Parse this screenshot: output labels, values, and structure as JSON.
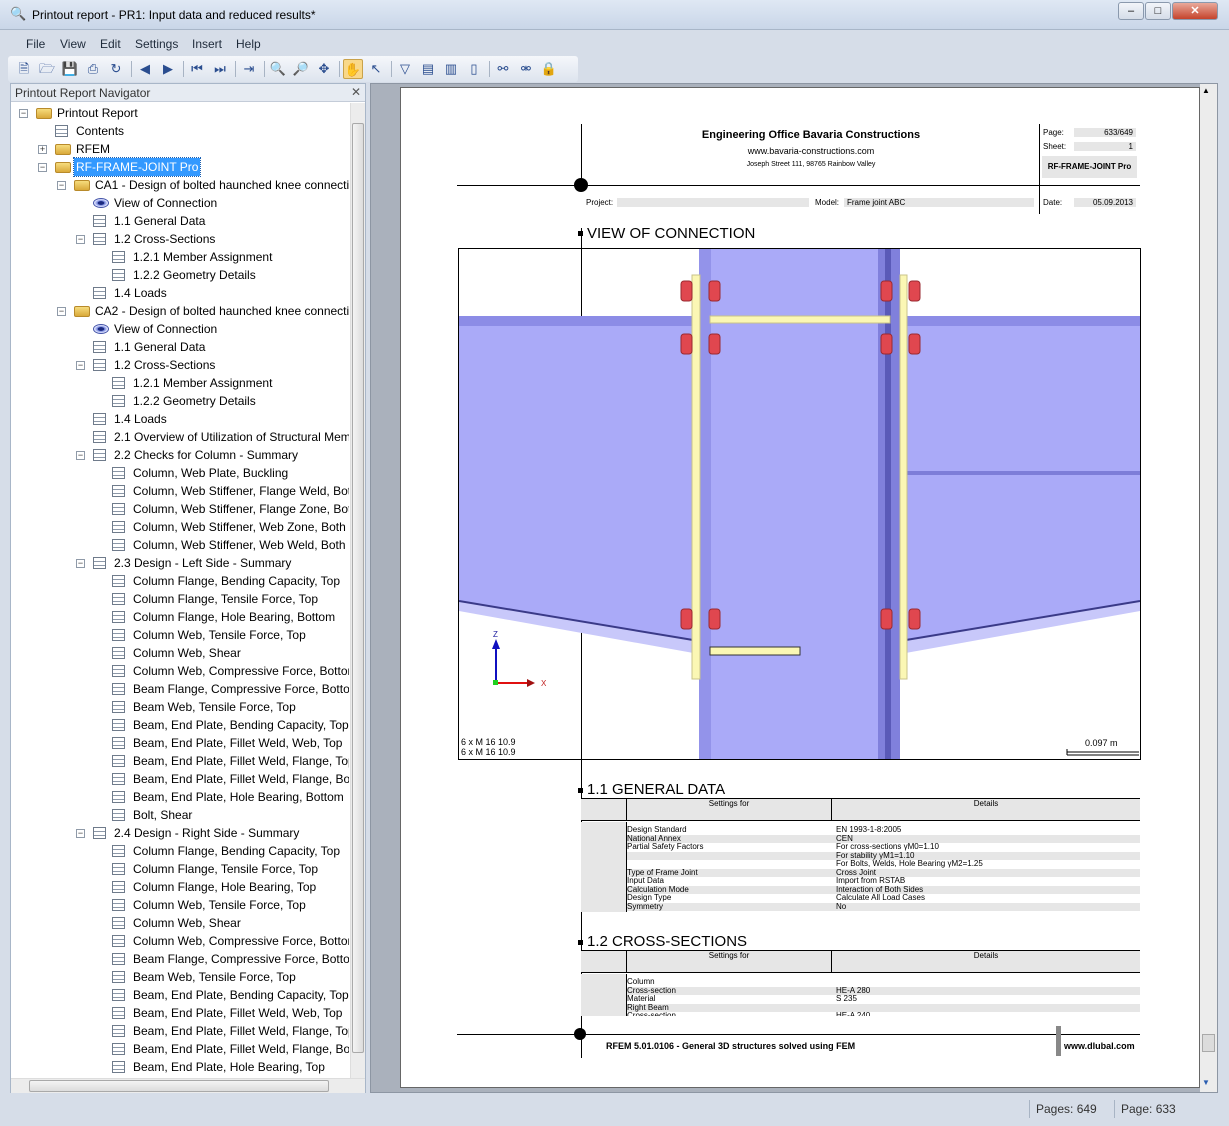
{
  "window": {
    "title": "Printout report - PR1: Input data and reduced results*",
    "buttons": [
      "minimize",
      "maximize",
      "close"
    ]
  },
  "menu": [
    "File",
    "View",
    "Edit",
    "Settings",
    "Insert",
    "Help"
  ],
  "toolbar": [
    "new-report-icon",
    "open-icon",
    "save-icon",
    "print-icon",
    "refresh-icon",
    "previous-icon",
    "next-icon",
    "first-page-icon",
    "last-page-icon",
    "export-icon",
    "zoom-in-icon",
    "zoom-out-icon",
    "move-icon",
    "hand-icon",
    "select-icon",
    "filter-page-icon",
    "page-icon",
    "pages-icon",
    "blank-page-icon",
    "link-icon",
    "unlink-icon",
    "lock-icon"
  ],
  "navigator": {
    "title": "Printout Report Navigator",
    "items": [
      {
        "label": "Printout Report",
        "level": 0,
        "icon": "folder",
        "exp": "-"
      },
      {
        "label": "Contents",
        "level": 1,
        "icon": "table"
      },
      {
        "label": "RFEM",
        "level": 1,
        "icon": "folder",
        "exp": "+"
      },
      {
        "label": "RF-FRAME-JOINT Pro",
        "level": 1,
        "icon": "folder",
        "exp": "-",
        "selected": true
      },
      {
        "label": "CA1 - Design of bolted haunched knee connectio",
        "level": 2,
        "icon": "folder",
        "exp": "-"
      },
      {
        "label": "View of Connection",
        "level": 3,
        "icon": "eye"
      },
      {
        "label": "1.1 General Data",
        "level": 3,
        "icon": "table"
      },
      {
        "label": "1.2 Cross-Sections",
        "level": 3,
        "icon": "table",
        "exp": "-"
      },
      {
        "label": "1.2.1 Member Assignment",
        "level": 4,
        "icon": "table"
      },
      {
        "label": "1.2.2 Geometry Details",
        "level": 4,
        "icon": "table"
      },
      {
        "label": "1.4 Loads",
        "level": 3,
        "icon": "table"
      },
      {
        "label": "CA2 - Design of bolted haunched knee connectio",
        "level": 2,
        "icon": "folder",
        "exp": "-"
      },
      {
        "label": "View of Connection",
        "level": 3,
        "icon": "eye"
      },
      {
        "label": "1.1 General Data",
        "level": 3,
        "icon": "table"
      },
      {
        "label": "1.2 Cross-Sections",
        "level": 3,
        "icon": "table",
        "exp": "-"
      },
      {
        "label": "1.2.1 Member Assignment",
        "level": 4,
        "icon": "table"
      },
      {
        "label": "1.2.2 Geometry Details",
        "level": 4,
        "icon": "table"
      },
      {
        "label": "1.4 Loads",
        "level": 3,
        "icon": "table"
      },
      {
        "label": "2.1 Overview of Utilization of Structural Mem",
        "level": 3,
        "icon": "table"
      },
      {
        "label": "2.2 Checks for Column - Summary",
        "level": 3,
        "icon": "table",
        "exp": "-"
      },
      {
        "label": "Column, Web Plate, Buckling",
        "level": 4,
        "icon": "table"
      },
      {
        "label": "Column, Web Stiffener, Flange Weld, Both",
        "level": 4,
        "icon": "table"
      },
      {
        "label": "Column, Web Stiffener, Flange Zone, Both",
        "level": 4,
        "icon": "table"
      },
      {
        "label": "Column, Web Stiffener, Web Zone, Both S",
        "level": 4,
        "icon": "table"
      },
      {
        "label": "Column, Web Stiffener, Web Weld, Both S",
        "level": 4,
        "icon": "table"
      },
      {
        "label": "2.3 Design - Left Side - Summary",
        "level": 3,
        "icon": "table",
        "exp": "-"
      },
      {
        "label": "Column Flange, Bending Capacity, Top",
        "level": 4,
        "icon": "table"
      },
      {
        "label": "Column Flange, Tensile Force, Top",
        "level": 4,
        "icon": "table"
      },
      {
        "label": "Column Flange, Hole Bearing, Bottom",
        "level": 4,
        "icon": "table"
      },
      {
        "label": "Column Web, Tensile Force, Top",
        "level": 4,
        "icon": "table"
      },
      {
        "label": "Column Web, Shear",
        "level": 4,
        "icon": "table"
      },
      {
        "label": "Column Web, Compressive Force, Bottom",
        "level": 4,
        "icon": "table"
      },
      {
        "label": "Beam Flange, Compressive Force, Bottom",
        "level": 4,
        "icon": "table"
      },
      {
        "label": "Beam Web, Tensile Force, Top",
        "level": 4,
        "icon": "table"
      },
      {
        "label": "Beam, End Plate, Bending Capacity, Top",
        "level": 4,
        "icon": "table"
      },
      {
        "label": "Beam, End Plate, Fillet Weld, Web, Top",
        "level": 4,
        "icon": "table"
      },
      {
        "label": "Beam, End Plate, Fillet Weld, Flange, Top",
        "level": 4,
        "icon": "table"
      },
      {
        "label": "Beam, End Plate, Fillet Weld, Flange, Botto",
        "level": 4,
        "icon": "table"
      },
      {
        "label": "Beam, End Plate, Hole Bearing, Bottom",
        "level": 4,
        "icon": "table"
      },
      {
        "label": "Bolt, Shear",
        "level": 4,
        "icon": "table"
      },
      {
        "label": "2.4 Design - Right Side - Summary",
        "level": 3,
        "icon": "table",
        "exp": "-"
      },
      {
        "label": "Column Flange, Bending Capacity, Top",
        "level": 4,
        "icon": "table"
      },
      {
        "label": "Column Flange, Tensile Force, Top",
        "level": 4,
        "icon": "table"
      },
      {
        "label": "Column Flange, Hole Bearing, Top",
        "level": 4,
        "icon": "table"
      },
      {
        "label": "Column Web, Tensile Force, Top",
        "level": 4,
        "icon": "table"
      },
      {
        "label": "Column Web, Shear",
        "level": 4,
        "icon": "table"
      },
      {
        "label": "Column Web, Compressive Force, Bottom",
        "level": 4,
        "icon": "table"
      },
      {
        "label": "Beam Flange, Compressive Force, Bottom",
        "level": 4,
        "icon": "table"
      },
      {
        "label": "Beam Web, Tensile Force, Top",
        "level": 4,
        "icon": "table"
      },
      {
        "label": "Beam, End Plate, Bending Capacity, Top",
        "level": 4,
        "icon": "table"
      },
      {
        "label": "Beam, End Plate, Fillet Weld, Web, Top",
        "level": 4,
        "icon": "table"
      },
      {
        "label": "Beam, End Plate, Fillet Weld, Flange, Top",
        "level": 4,
        "icon": "table"
      },
      {
        "label": "Beam, End Plate, Fillet Weld, Flange, Botto",
        "level": 4,
        "icon": "table"
      },
      {
        "label": "Beam, End Plate, Hole Bearing, Top",
        "level": 4,
        "icon": "table"
      }
    ]
  },
  "report": {
    "company": "Engineering Office Bavaria Constructions",
    "website": "www.bavaria-constructions.com",
    "address": "Joseph Street 111, 98765 Rainbow Valley",
    "page_label": "Page:",
    "page_value": "633/649",
    "sheet_label": "Sheet:",
    "sheet_value": "1",
    "module": "RF-FRAME-JOINT Pro",
    "project_label": "Project:",
    "project_value": "",
    "model_label": "Model:",
    "model_value": "Frame joint ABC",
    "date_label": "Date:",
    "date_value": "05.09.2013",
    "view_title": "VIEW OF CONNECTION",
    "view": {
      "axis_z": "Z",
      "axis_x": "X",
      "bolts_1": "6 x M 16 10.9",
      "bolts_2": "6 x M 16 10.9",
      "scale": "0.097 m",
      "colors": {
        "steel": "#aaaaf8",
        "plate": "#fbf7b4",
        "bolt": "#e0474f"
      }
    },
    "general": {
      "title": "1.1 GENERAL DATA",
      "col1": "Settings for",
      "col2": "Details",
      "rows": [
        [
          "Design Standard",
          "EN 1993-1-8:2005"
        ],
        [
          "National Annex",
          "CEN"
        ],
        [
          "Partial Safety Factors",
          "For cross-sections γM0=1.10"
        ],
        [
          "",
          "For stability γM1=1.10"
        ],
        [
          "",
          "For Bolts, Welds, Hole Bearing γM2=1.25"
        ],
        [
          "Type of Frame Joint",
          "Cross Joint"
        ],
        [
          "Input Data",
          "Import from RSTAB"
        ],
        [
          "Calculation Mode",
          "Interaction of Both Sides"
        ],
        [
          "Design Type",
          "Calculate All Load Cases"
        ],
        [
          "Symmetry",
          "No"
        ]
      ]
    },
    "cross": {
      "title": "1.2 CROSS-SECTIONS",
      "col1": "Settings for",
      "col2": "Details",
      "rows": [
        [
          "Column",
          ""
        ],
        [
          "Cross-section",
          "HE-A 280"
        ],
        [
          "Material",
          "S 235"
        ],
        [
          "Right Beam",
          ""
        ],
        [
          "Cross-section",
          "HE-A 240"
        ]
      ]
    },
    "footer_left": "RFEM 5.01.0106 - General 3D structures solved using FEM",
    "footer_right": "www.dlubal.com"
  },
  "status": {
    "pages": "Pages: 649",
    "page": "Page: 633"
  }
}
